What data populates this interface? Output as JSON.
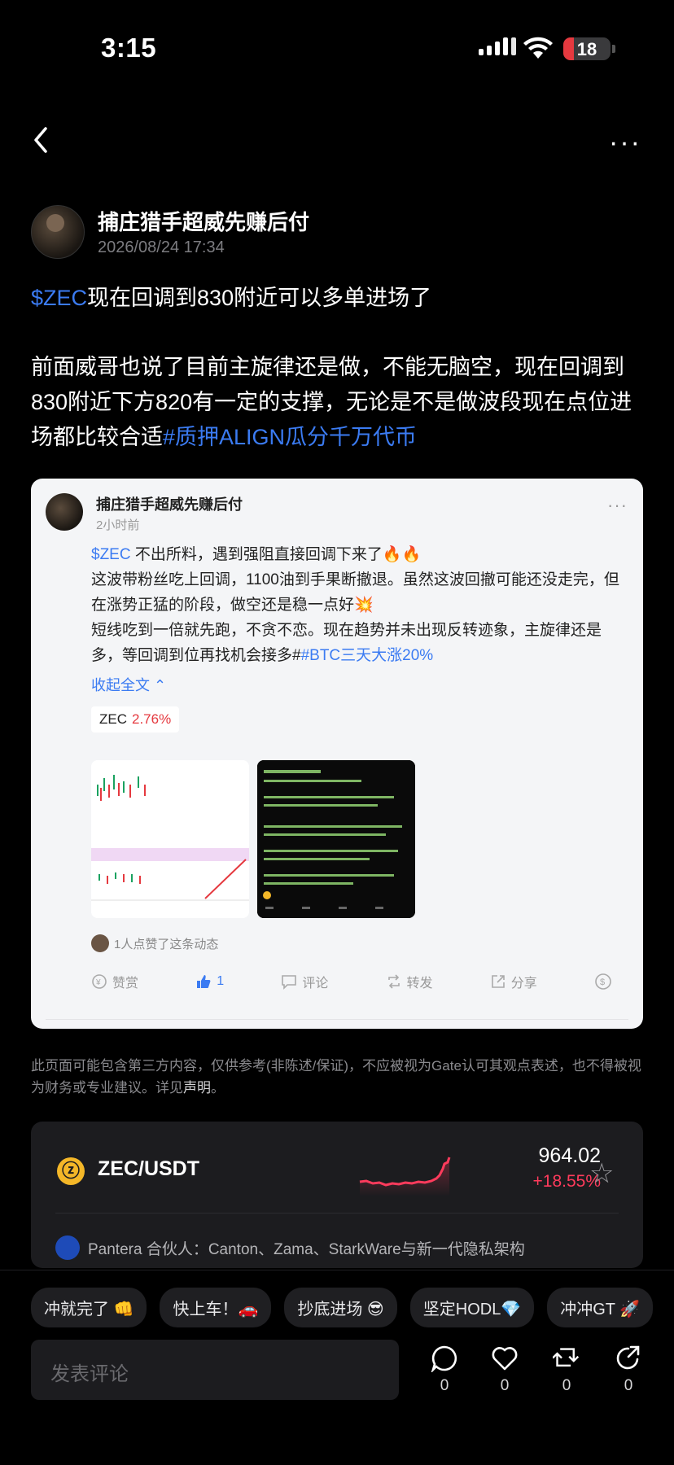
{
  "status": {
    "time": "3:15",
    "battery": "18"
  },
  "post": {
    "author": "捕庄猎手超威先赚后付",
    "timestamp": "2026/08/24 17:34",
    "ticker_tag": "$ZEC",
    "line1_rest": "现在回调到830附近可以多单进场了",
    "body": "前面威哥也说了目前主旋律还是做，不能无脑空，现在回调到830附近下方820有一定的支撑，无论是不是做波段现在点位进场都比较合适",
    "hashtag": "#质押ALIGN瓜分千万代币"
  },
  "quoted": {
    "author": "捕庄猎手超威先赚后付",
    "time": "2小时前",
    "ticker_tag": "$ZEC",
    "text_a": " 不出所料，遇到强阻直接回调下来了🔥🔥",
    "text_b": "这波带粉丝吃上回调，1100油到手果断撤退。虽然这波回撤可能还没走完，但在涨势正猛的阶段，做空还是稳一点好💥",
    "text_c": "短线吃到一倍就先跑，不贪不恋。现在趋势并未出现反转迹象，主旋律还是多，等回调到位再找机会接多#",
    "hashtag": "#BTC三天大涨20%",
    "collapse_label": "收起全文 ⌃",
    "ticker_symbol": "ZEC",
    "ticker_change": "2.76%",
    "likers_text": "1人点赞了这条动态",
    "actions": {
      "reward": "赞赏",
      "like_count": "1",
      "comment": "评论",
      "repost": "转发",
      "share": "分享"
    }
  },
  "disclaimer": {
    "text": "此页面可能包含第三方内容，仅供参考(非陈述/保证)，不应被视为Gate认可其观点表述，也不得被视为财务或专业建议。详见",
    "link": "声明",
    "end": "。"
  },
  "market": {
    "pair": "ZEC/USDT",
    "price": "964.02",
    "change": "+18.55%",
    "news": "Pantera 合伙人：Canton、Zama、StarkWare与新一代隐私架构"
  },
  "chips": [
    "冲就完了 👊",
    "快上车！🚗",
    "抄底进场 😎",
    "坚定HODL💎",
    "冲冲GT 🚀"
  ],
  "comment_placeholder": "发表评论",
  "counts": {
    "comments": "0",
    "likes": "0",
    "reposts": "0",
    "shares": "0"
  },
  "colors": {
    "link": "#3b7bf2",
    "up": "#ff3b5c",
    "zec": "#f4b728"
  }
}
